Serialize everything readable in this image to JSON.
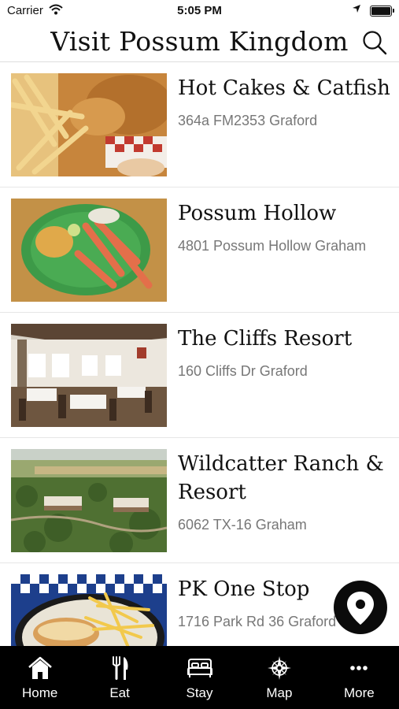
{
  "status_bar": {
    "carrier": "Carrier",
    "time": "5:05 PM"
  },
  "header": {
    "title": "Visit Possum Kingdom"
  },
  "listings": [
    {
      "name": "Hot Cakes & Catfish",
      "address": "364a FM2353 Graford",
      "image": "fried-catfish-fries-photo"
    },
    {
      "name": "Possum Hollow",
      "address": "4801 Possum Hollow Graham",
      "image": "crab-legs-plate-photo"
    },
    {
      "name": "The Cliffs Resort",
      "address": "160 Cliffs Dr Graford",
      "image": "restaurant-dining-room-photo"
    },
    {
      "name": "Wildcatter Ranch & Resort",
      "address": "6062 TX-16 Graham",
      "image": "aerial-ranch-photo"
    },
    {
      "name": "PK One Stop",
      "address": "1716 Park Rd 36 Graford",
      "image": "sandwich-fries-basket-photo"
    }
  ],
  "map_button": {
    "icon": "map-pin-icon"
  },
  "tabbar": {
    "tabs": [
      {
        "label": "Home",
        "icon": "home-icon"
      },
      {
        "label": "Eat",
        "icon": "fork-knife-icon"
      },
      {
        "label": "Stay",
        "icon": "bed-icon"
      },
      {
        "label": "Map",
        "icon": "compass-icon"
      },
      {
        "label": "More",
        "icon": "more-icon"
      }
    ]
  },
  "colors": {
    "tabbar_bg": "#000000",
    "fab_bg": "#0b0b0b",
    "address_text": "#777777"
  }
}
